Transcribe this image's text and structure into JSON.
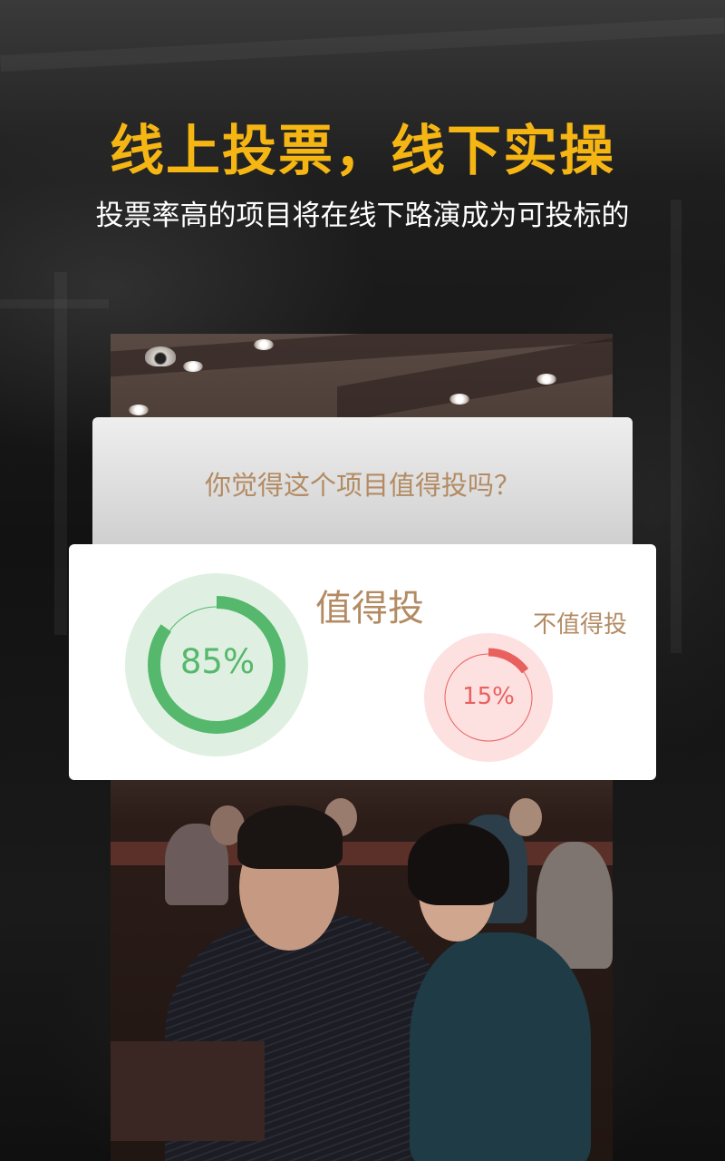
{
  "headline": "线上投票，线下实操",
  "subline": "投票率高的项目将在线下路演成为可投标的",
  "question": "你觉得这个项目值得投吗？",
  "results": {
    "yes": {
      "label": "值得投",
      "percent_text": "85%",
      "fraction": 0.85,
      "color": "#55b86c"
    },
    "no": {
      "label": "不值得投",
      "percent_text": "15%",
      "fraction": 0.15,
      "color": "#e8615e"
    }
  },
  "colors": {
    "accent_title": "#f5b614",
    "label_tan": "#b38b63"
  }
}
